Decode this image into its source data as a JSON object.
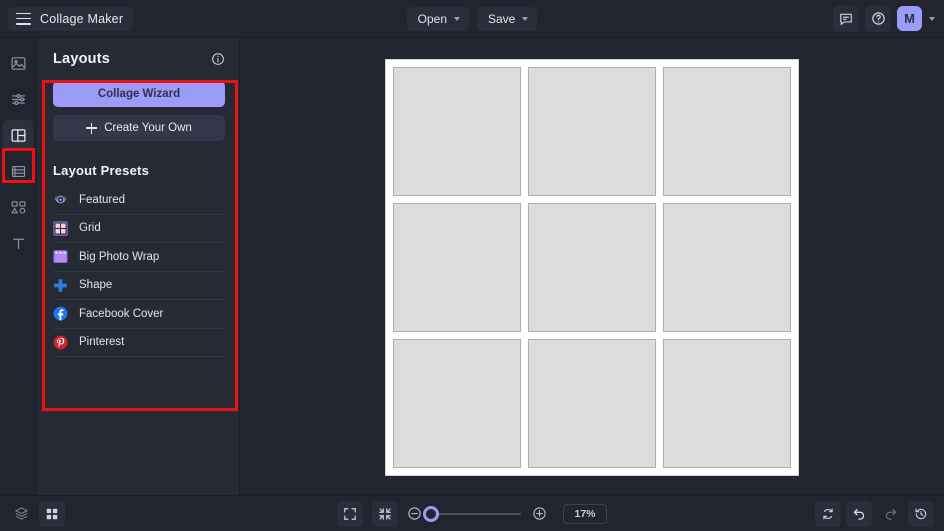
{
  "app": {
    "title": "Collage Maker",
    "menu_icon": "hamburger-icon"
  },
  "topbar": {
    "open_label": "Open",
    "save_label": "Save",
    "feedback_icon": "chat-bubble-icon",
    "help_icon": "help-circle-icon",
    "avatar_initial": "M"
  },
  "rail": {
    "items": [
      {
        "name": "sidebar-item-photos",
        "icon": "image-icon",
        "active": false
      },
      {
        "name": "sidebar-item-adjust",
        "icon": "sliders-icon",
        "active": false
      },
      {
        "name": "sidebar-item-layouts",
        "icon": "layout-icon",
        "active": true
      },
      {
        "name": "sidebar-item-background",
        "icon": "layers-rows-icon",
        "active": false
      },
      {
        "name": "sidebar-item-elements",
        "icon": "shapes-icon",
        "active": false
      },
      {
        "name": "sidebar-item-text",
        "icon": "text-t-icon",
        "active": false
      }
    ]
  },
  "panel": {
    "title": "Layouts",
    "info_icon": "info-circle-icon",
    "wizard_label": "Collage Wizard",
    "create_own_label": "Create Your Own",
    "create_own_icon": "plus-icon",
    "presets_title": "Layout Presets",
    "presets": [
      {
        "label": "Featured",
        "icon": "laurel-badge-icon",
        "color": "#7f91c9"
      },
      {
        "label": "Grid",
        "icon": "grid-squares-icon",
        "color": "#f3c7d7"
      },
      {
        "label": "Big Photo Wrap",
        "icon": "photo-frame-icon",
        "color": "#b58df0"
      },
      {
        "label": "Shape",
        "icon": "cross-shape-icon",
        "color": "#2f7fe0"
      },
      {
        "label": "Facebook Cover",
        "icon": "facebook-icon",
        "color": "#1977f3"
      },
      {
        "label": "Pinterest",
        "icon": "pinterest-icon",
        "color": "#d2232a"
      }
    ]
  },
  "canvas": {
    "cells": [
      1,
      2,
      3,
      4,
      5,
      6,
      7,
      8,
      9
    ],
    "board_color": "#ffffff",
    "cell_color": "#dcdcdc"
  },
  "bottombar": {
    "layers_icon": "layers-stack-icon",
    "grid_toggle_icon": "grid-four-icon",
    "fit_icon": "expand-frame-icon",
    "shrink_icon": "collapse-frame-icon",
    "zoom_out_icon": "minus-circle-icon",
    "zoom_in_icon": "plus-circle-icon",
    "zoom_value": "17%",
    "zoom_percent": 17,
    "reset_icon": "refresh-icon",
    "undo_icon": "undo-arrow-icon",
    "redo_icon": "redo-arrow-icon",
    "history_icon": "history-clock-icon"
  },
  "annotations": {
    "accent_color": "#ee1111",
    "boxes": [
      {
        "name": "highlight-layouts-panel",
        "target": "panel"
      },
      {
        "name": "highlight-layouts-rail-icon",
        "target": "rail"
      }
    ]
  }
}
